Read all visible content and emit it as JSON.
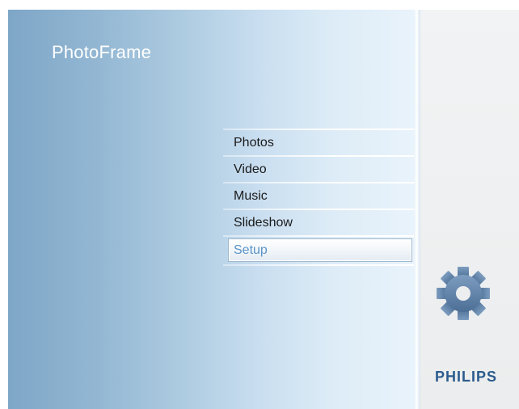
{
  "app": {
    "title": "PhotoFrame"
  },
  "menu": {
    "items": [
      {
        "label": "Photos",
        "selected": false
      },
      {
        "label": "Video",
        "selected": false
      },
      {
        "label": "Music",
        "selected": false
      },
      {
        "label": "Slideshow",
        "selected": false
      },
      {
        "label": "Setup",
        "selected": true
      }
    ]
  },
  "side_panel": {
    "icon": "gear-icon",
    "brand": "PHILIPS"
  },
  "colors": {
    "accent": "#5a94c8",
    "brand": "#2c5c8e",
    "gear": "#5b7fa6"
  }
}
